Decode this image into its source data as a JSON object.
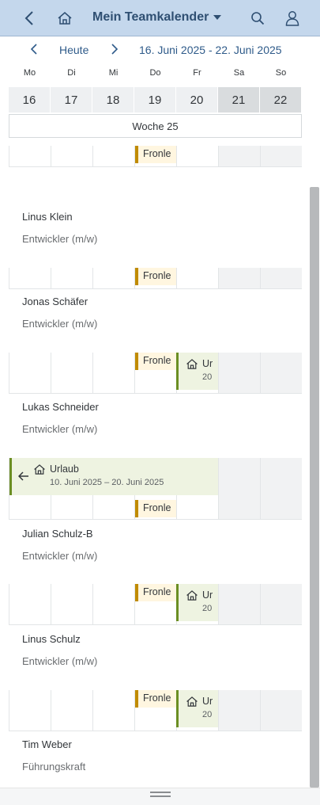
{
  "header": {
    "title": "Mein Teamkalender"
  },
  "nav": {
    "today_label": "Heute",
    "range_label": "16. Juni 2025 - 22. Juni 2025"
  },
  "days": [
    "Mo",
    "Di",
    "Mi",
    "Do",
    "Fr",
    "Sa",
    "So"
  ],
  "dates": [
    "16",
    "17",
    "18",
    "19",
    "20",
    "21",
    "22"
  ],
  "week_label": "Woche 25",
  "appointments": {
    "holiday": "Fronle",
    "vacation_short": "Ur",
    "vacation_short_sub": "20",
    "vacation_title": "Urlaub",
    "vacation_range": "10. Juni 2025 – 20. Juni 2025"
  },
  "people": [
    {
      "name": "Linus Klein",
      "role": "Entwickler (m/w)"
    },
    {
      "name": "Jonas Schäfer",
      "role": "Entwickler (m/w)"
    },
    {
      "name": "Lukas Schneider",
      "role": "Entwickler (m/w)"
    },
    {
      "name": "Julian Schulz-B",
      "role": "Entwickler (m/w)"
    },
    {
      "name": "Linus Schulz",
      "role": "Entwickler (m/w)"
    },
    {
      "name": "Tim Weber",
      "role": "Führungskraft"
    }
  ],
  "colors": {
    "header_bg": "#c4d7ec",
    "accent": "#2f5b8a",
    "holiday": "#c08b00",
    "vacation": "#6b8e23"
  }
}
